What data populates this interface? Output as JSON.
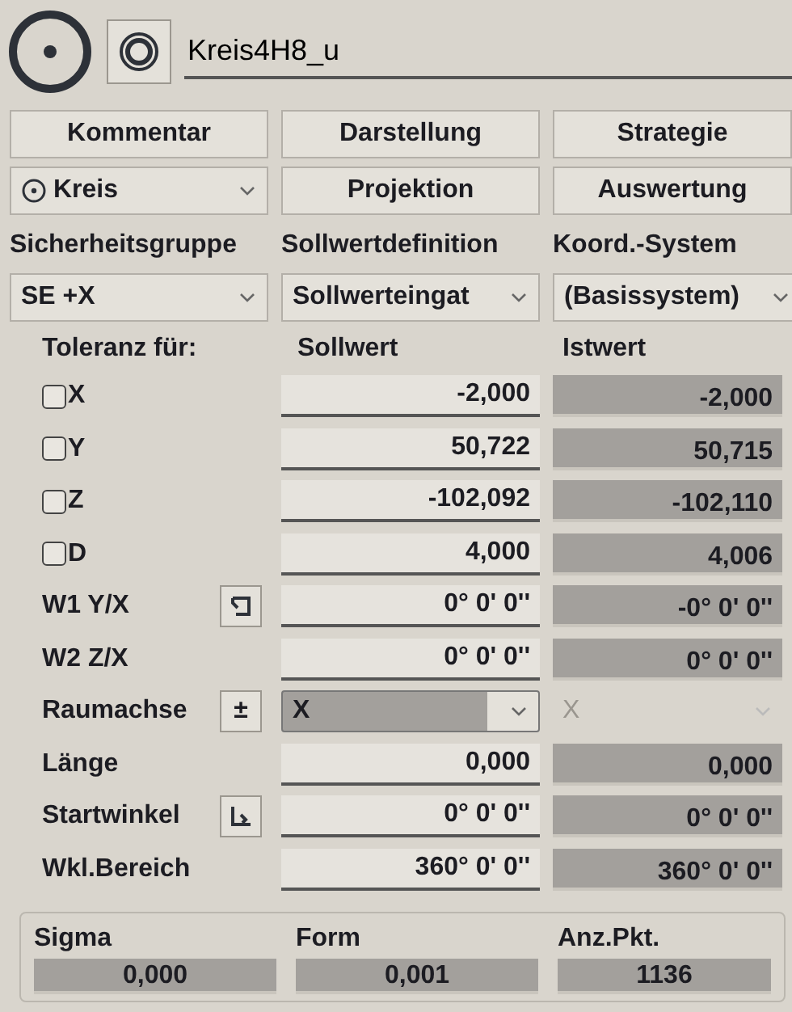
{
  "feature": {
    "name": "Kreis4H8_u"
  },
  "buttons_row1": [
    "Kommentar",
    "Darstellung",
    "Strategie"
  ],
  "geometry_select": {
    "value": "Kreis"
  },
  "buttons_row2": [
    "Projektion",
    "Auswertung"
  ],
  "settings": [
    {
      "label": "Sicherheitsgruppe",
      "value": "SE +X"
    },
    {
      "label": "Sollwertdefinition",
      "value": "Sollwerteingat"
    },
    {
      "label": "Koord.-System",
      "value": "(Basissystem)"
    }
  ],
  "tolerance": {
    "header": "Toleranz für:",
    "columns": [
      "Sollwert",
      "Istwert"
    ],
    "rows": [
      {
        "kind": "check",
        "label": "X",
        "checked": false,
        "nominal": "-2,000",
        "actual": "-2,000"
      },
      {
        "kind": "check",
        "label": "Y",
        "checked": false,
        "nominal": "50,722",
        "actual": "50,715"
      },
      {
        "kind": "check",
        "label": "Z",
        "checked": false,
        "nominal": "-102,092",
        "actual": "-102,110"
      },
      {
        "kind": "check",
        "label": "D",
        "checked": false,
        "nominal": "4,000",
        "actual": "4,006"
      },
      {
        "kind": "rotate",
        "label": "W1 Y/X",
        "nominal": "0° 0' 0''",
        "actual": "-0° 0' 0''"
      },
      {
        "kind": "plain",
        "label": "W2 Z/X",
        "nominal": "0° 0' 0''",
        "actual": "0° 0' 0''"
      },
      {
        "kind": "select",
        "symbol": "±",
        "label": "Raumachse",
        "nominal": "X",
        "actual": "X",
        "actual_disabled": true
      },
      {
        "kind": "plain",
        "label": "Länge",
        "nominal": "0,000",
        "actual": "0,000"
      },
      {
        "kind": "angle",
        "label": "Startwinkel",
        "nominal": "0° 0' 0''",
        "actual": "0° 0' 0''"
      },
      {
        "kind": "plain",
        "label": "Wkl.Bereich",
        "nominal": "360° 0' 0''",
        "actual": "360° 0' 0''"
      }
    ]
  },
  "stats": [
    {
      "label": "Sigma",
      "value": "0,000"
    },
    {
      "label": "Form",
      "value": "0,001"
    },
    {
      "label": "Anz.Pkt.",
      "value": "1136"
    }
  ]
}
